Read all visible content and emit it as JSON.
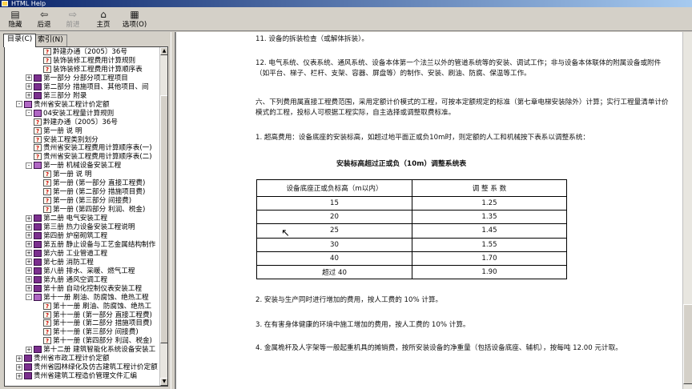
{
  "window": {
    "title": "HTML Help"
  },
  "toolbar": {
    "hide": "隐藏",
    "back": "后退",
    "forward": "前进",
    "home": "主页",
    "options": "选项(O)"
  },
  "tabs": {
    "contents": "目录(C)",
    "index": "索引(N)"
  },
  "tree": [
    {
      "indent": 2,
      "toggle": "",
      "icon": "page",
      "label": "黔建办通〔2005〕36号"
    },
    {
      "indent": 2,
      "toggle": "",
      "icon": "page",
      "label": "装饰装修工程费用计算规则"
    },
    {
      "indent": 2,
      "toggle": "",
      "icon": "page",
      "label": "装饰装修工程费用计算顺序表"
    },
    {
      "indent": 1,
      "toggle": "+",
      "icon": "book",
      "label": "第一部分  分部分项工程项目"
    },
    {
      "indent": 1,
      "toggle": "+",
      "icon": "book",
      "label": "第二部分  措施项目、其他项目、间"
    },
    {
      "indent": 1,
      "toggle": "+",
      "icon": "book",
      "label": "第三部分  附录"
    },
    {
      "indent": 0,
      "toggle": "-",
      "icon": "bookopen",
      "label": "贵州省安装工程计价定额"
    },
    {
      "indent": 1,
      "toggle": "-",
      "icon": "bookopen",
      "label": "04安装工程量计算规则"
    },
    {
      "indent": 1,
      "toggle": "",
      "icon": "page",
      "label": "黔建办通〔2005〕36号"
    },
    {
      "indent": 1,
      "toggle": "",
      "icon": "page",
      "label": "第一册 说 明"
    },
    {
      "indent": 1,
      "toggle": "",
      "icon": "page",
      "label": "安装工程类别划分"
    },
    {
      "indent": 1,
      "toggle": "",
      "icon": "page",
      "label": "贵州省安装工程费用计算顺序表(一)"
    },
    {
      "indent": 1,
      "toggle": "",
      "icon": "page",
      "label": "贵州省安装工程费用计算顺序表(二)"
    },
    {
      "indent": 1,
      "toggle": "-",
      "icon": "bookopen",
      "label": "第一册  机械设备安装工程"
    },
    {
      "indent": 2,
      "toggle": "",
      "icon": "page",
      "label": "第一册 说 明"
    },
    {
      "indent": 2,
      "toggle": "",
      "icon": "page",
      "label": "第一册 (第一部分  直接工程费)"
    },
    {
      "indent": 2,
      "toggle": "",
      "icon": "page",
      "label": "第一册 (第二部分  措施项目费)"
    },
    {
      "indent": 2,
      "toggle": "",
      "icon": "page",
      "label": "第一册 (第三部分 间接费)"
    },
    {
      "indent": 2,
      "toggle": "",
      "icon": "page",
      "label": "第一册 (第四部分 利润、税金)"
    },
    {
      "indent": 1,
      "toggle": "+",
      "icon": "book",
      "label": "第二册  电气安装工程"
    },
    {
      "indent": 1,
      "toggle": "+",
      "icon": "book",
      "label": "第三册  热力设备安装工程说明"
    },
    {
      "indent": 1,
      "toggle": "+",
      "icon": "book",
      "label": "第四册  炉窑砌筑工程"
    },
    {
      "indent": 1,
      "toggle": "+",
      "icon": "book",
      "label": "第五册  静止设备与工艺金属结构制作"
    },
    {
      "indent": 1,
      "toggle": "+",
      "icon": "book",
      "label": "第六册  工业管道工程"
    },
    {
      "indent": 1,
      "toggle": "+",
      "icon": "book",
      "label": "第七册  消防工程"
    },
    {
      "indent": 1,
      "toggle": "+",
      "icon": "book",
      "label": "第八册  排水、采暖、燃气工程"
    },
    {
      "indent": 1,
      "toggle": "+",
      "icon": "book",
      "label": "第九册  通风空调工程"
    },
    {
      "indent": 1,
      "toggle": "+",
      "icon": "book",
      "label": "第十册  自动化控制仪表安装工程"
    },
    {
      "indent": 1,
      "toggle": "-",
      "icon": "bookopen",
      "label": "第十一册  刷油、防腐蚀、绝热工程"
    },
    {
      "indent": 2,
      "toggle": "",
      "icon": "page",
      "label": "第十一册 刷油、防腐蚀、绝热工"
    },
    {
      "indent": 2,
      "toggle": "",
      "icon": "page",
      "label": "第十一册 (第一部分  直接工程费)"
    },
    {
      "indent": 2,
      "toggle": "",
      "icon": "page",
      "label": "第十一册 (第二部分 措施项目费)"
    },
    {
      "indent": 2,
      "toggle": "",
      "icon": "page",
      "label": "第十一册 (第三部分 间接费)"
    },
    {
      "indent": 2,
      "toggle": "",
      "icon": "page",
      "label": "第十一册 (第四部分 利润、税金)"
    },
    {
      "indent": 1,
      "toggle": "+",
      "icon": "book",
      "label": "第十二册  建筑智能化系统设备安装工"
    },
    {
      "indent": 0,
      "toggle": "+",
      "icon": "book",
      "label": "贵州省市政工程计价定额"
    },
    {
      "indent": 0,
      "toggle": "+",
      "icon": "book",
      "label": "贵州省园林绿化及仿古建筑工程计价定额"
    },
    {
      "indent": 0,
      "toggle": "+",
      "icon": "book",
      "label": "贵州省建筑工程造价管理文件汇编"
    }
  ],
  "content": {
    "p11": "11. 设备的拆装检查（或解体拆装）。",
    "p12": "12. 电气系统、仪表系统、通风系统、设备本体第一个法兰以外的管道系统等的安装、调试工作；非与设备本体联体的附属设备或附件（如平台、梯子、栏杆、支架、容器、屏盘等）的制作、安装、刷油、防腐、保温等工作。",
    "p6": "六、下列费用属直接工程费范围，采用定额计价模式的工程，可按本定额规定的标准（第七章电梯安装除外）计算；实行工程量清单计价模式的工程，投标人可根据工程实际，自主选择或调整取费标准。",
    "pe1": "1. 超高费用：设备底座的安装标高，如超过地平面正或负10m时，则定额的人工和机械按下表系以调整系统：",
    "table_title": "安装标高超过正或负（10m）调整系统表",
    "table_headers": [
      "设备底座正或负标高（m以内）",
      "调 整 系 数"
    ],
    "table_rows": [
      [
        "15",
        "1.25"
      ],
      [
        "20",
        "1.35"
      ],
      [
        "25",
        "1.45"
      ],
      [
        "30",
        "1.55"
      ],
      [
        "40",
        "1.70"
      ],
      [
        "超过 40",
        "1.90"
      ]
    ],
    "pe2": "2. 安装与生产同时进行增加的费用，按人工费的 10% 计算。",
    "pe3": "3. 在有害身体健康的环境中施工增加的费用，按人工费的 10% 计算。",
    "pe4": "4. 金属桅杆及人字架等一般起重机具的摊销费，按所安装设备的净重量（包括设备底座、辅机），按每吨 12.00 元计取。"
  },
  "icons": {
    "hide": "hide-pane-icon",
    "back": "back-arrow-icon",
    "forward": "forward-arrow-icon",
    "home": "home-icon",
    "options": "options-icon",
    "page": "topic-page-icon",
    "book": "closed-book-icon",
    "bookopen": "open-book-icon"
  }
}
